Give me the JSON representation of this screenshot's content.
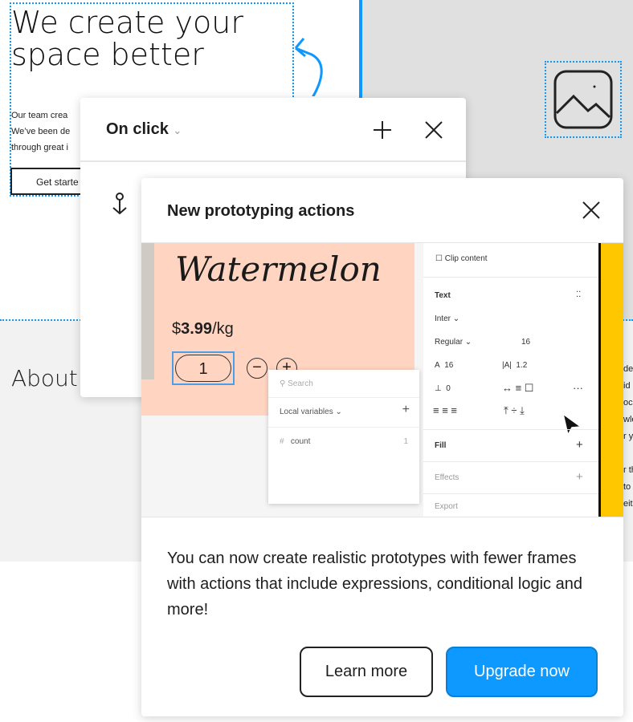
{
  "canvas": {
    "hero_title": "We create your space better",
    "hero_body": [
      "Our team crea",
      "We’ve been de",
      "through great i"
    ],
    "cta": "Get starte",
    "about": "About",
    "right_text": [
      "des",
      "id",
      "oc",
      "wle",
      "r y",
      "",
      "r th",
      "to",
      "eiti"
    ]
  },
  "interaction_popover": {
    "trigger": "On click",
    "add_icon": "plus-icon",
    "close_icon": "close-icon",
    "anchor_icon": "anchor-icon"
  },
  "announcement": {
    "title": "New prototyping actions",
    "preview": {
      "product": "Watermelon",
      "price_prefix": "$",
      "price": "3.99",
      "price_unit": "/kg",
      "quantity": "1",
      "variables": {
        "search_placeholder": "Search",
        "section": "Local variables",
        "items": [
          {
            "name": "count",
            "value": "1"
          }
        ]
      },
      "panel": {
        "clip": "Clip content",
        "text_section": "Text",
        "font": "Inter",
        "weight": "Regular",
        "size": "16",
        "line_height": "16",
        "letter_spacing": "1.2",
        "paragraph": "0",
        "fill": "Fill",
        "effects": "Effects",
        "export": "Export"
      }
    },
    "description": "You can now create realistic prototypes with fewer frames with actions that include expressions, conditional logic and more!",
    "learn_more": "Learn more",
    "upgrade": "Upgrade now"
  },
  "colors": {
    "accent": "#0d99ff",
    "peach": "#ffd5c2",
    "yellow": "#ffc700"
  }
}
